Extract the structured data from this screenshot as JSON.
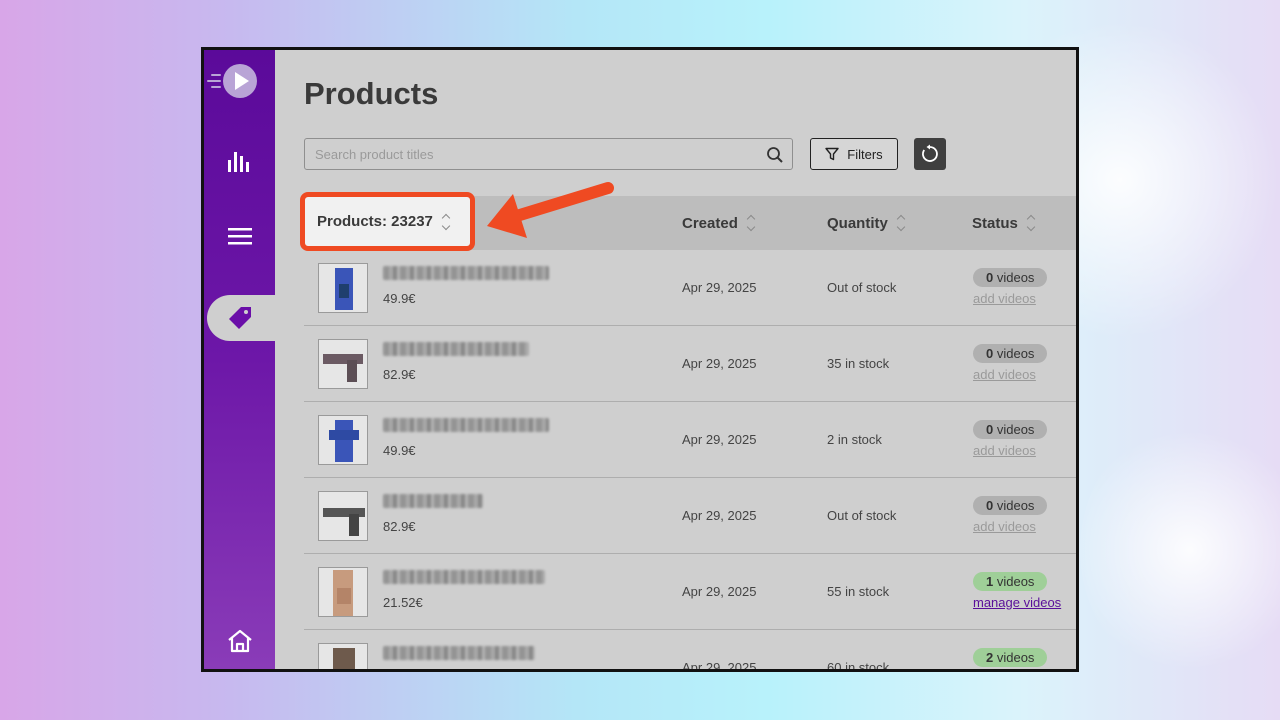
{
  "page": {
    "title": "Products"
  },
  "search": {
    "placeholder": "Search product titles"
  },
  "toolbar": {
    "filters_label": "Filters"
  },
  "table": {
    "headers": {
      "products": "Products: 23237",
      "created": "Created",
      "quantity": "Quantity",
      "status": "Status"
    },
    "rows": [
      {
        "price": "49.9€",
        "created": "Apr 29, 2025",
        "quantity": "Out of stock",
        "videos_count": "0",
        "videos_word": " videos",
        "action": "add videos",
        "has_videos": false
      },
      {
        "price": "82.9€",
        "created": "Apr 29, 2025",
        "quantity": "35 in stock",
        "videos_count": "0",
        "videos_word": " videos",
        "action": "add videos",
        "has_videos": false
      },
      {
        "price": "49.9€",
        "created": "Apr 29, 2025",
        "quantity": "2 in stock",
        "videos_count": "0",
        "videos_word": " videos",
        "action": "add videos",
        "has_videos": false
      },
      {
        "price": "82.9€",
        "created": "Apr 29, 2025",
        "quantity": "Out of stock",
        "videos_count": "0",
        "videos_word": " videos",
        "action": "add videos",
        "has_videos": false
      },
      {
        "price": "21.52€",
        "created": "Apr 29, 2025",
        "quantity": "55 in stock",
        "videos_count": "1",
        "videos_word": " videos",
        "action": "manage videos",
        "has_videos": true
      },
      {
        "price": "",
        "created": "Apr 29, 2025",
        "quantity": "60 in stock",
        "videos_count": "2",
        "videos_word": " videos",
        "action": "",
        "has_videos": true
      }
    ]
  },
  "sidebar": {
    "icons": [
      "logo-icon",
      "analytics-icon",
      "menu-icon",
      "tag-icon",
      "home-icon"
    ],
    "active": "tag-icon"
  },
  "colors": {
    "sidebar": "#5b0a9a",
    "highlight": "#ef4a22",
    "badge_green": "#9fcf98",
    "link_manage": "#5a0f9a"
  }
}
